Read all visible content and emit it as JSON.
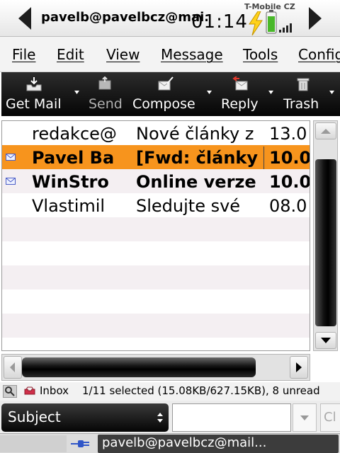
{
  "status_bar": {
    "account_title": "pavelb@pavelbcz@mai...",
    "time": "01:14",
    "carrier": "T-Mobile CZ",
    "icons": [
      "back-arrow-icon",
      "forward-arrow-icon",
      "charging-icon",
      "battery-icon",
      "signal-icon"
    ]
  },
  "menu": {
    "items": [
      "File",
      "Edit",
      "View",
      "Message",
      "Tools",
      "Config"
    ]
  },
  "toolbar": {
    "get_mail": "Get Mail",
    "send": "Send",
    "compose": "Compose",
    "reply": "Reply",
    "trash": "Trash"
  },
  "messages": [
    {
      "from": "redakce@",
      "subject": "Nové články z",
      "date": "13.0",
      "unread": false,
      "selected": false,
      "icon": ""
    },
    {
      "from": "Pavel Ba",
      "subject": "[Fwd: články",
      "date": "10.0",
      "unread": true,
      "selected": true,
      "icon": "envelope-icon"
    },
    {
      "from": "WinStro",
      "subject": "Online verze",
      "date": "10.0",
      "unread": true,
      "selected": false,
      "icon": "envelope-icon"
    },
    {
      "from": "Vlastimil",
      "subject": "Sledujte své",
      "date": "08.0",
      "unread": false,
      "selected": false,
      "icon": ""
    }
  ],
  "status_line": {
    "folder": "Inbox",
    "selection_info": "1/11 selected (15.08KB/627.15KB), 8 unread"
  },
  "search": {
    "field": "Subject",
    "value": "",
    "clear_label": "Cl"
  },
  "taskbar": {
    "window_title": "pavelb@pavelbcz@mail..."
  },
  "colors": {
    "selected_row": "#f7941d",
    "toolbar_bg": "#050505",
    "alt_row": "#f4eff2"
  }
}
